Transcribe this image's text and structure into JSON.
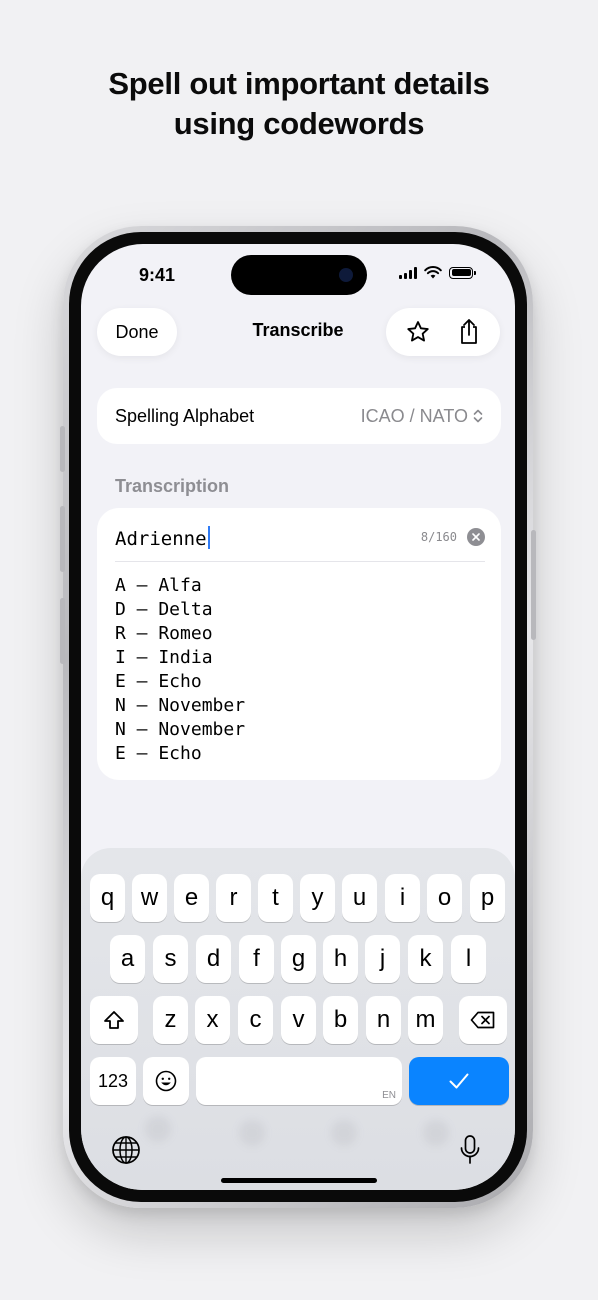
{
  "headline": {
    "line1": "Spell out important details",
    "line2": "using codewords"
  },
  "status": {
    "time": "9:41"
  },
  "nav": {
    "done_label": "Done",
    "title": "Transcribe"
  },
  "alphabet": {
    "label": "Spelling Alphabet",
    "value": "ICAO / NATO"
  },
  "transcription": {
    "section_label": "Transcription",
    "input_value": "Adrienne",
    "counter": "8/160",
    "codewords": [
      "A — Alfa",
      "D — Delta",
      "R — Romeo",
      "I — India",
      "E — Echo",
      "N — November",
      "N — November",
      "E — Echo"
    ]
  },
  "keyboard": {
    "row1": [
      "q",
      "w",
      "e",
      "r",
      "t",
      "y",
      "u",
      "i",
      "o",
      "p"
    ],
    "row2": [
      "a",
      "s",
      "d",
      "f",
      "g",
      "h",
      "j",
      "k",
      "l"
    ],
    "row3": [
      "z",
      "x",
      "c",
      "v",
      "b",
      "n",
      "m"
    ],
    "numbers_label": "123",
    "space_hint": "EN"
  },
  "colors": {
    "accent": "#0a84ff",
    "caret": "#2f7bf5"
  },
  "icons": [
    "star-icon",
    "share-icon",
    "chevron-updown-icon",
    "clear-icon",
    "shift-icon",
    "delete-icon",
    "emoji-icon",
    "checkmark-icon",
    "globe-icon",
    "microphone-icon"
  ]
}
